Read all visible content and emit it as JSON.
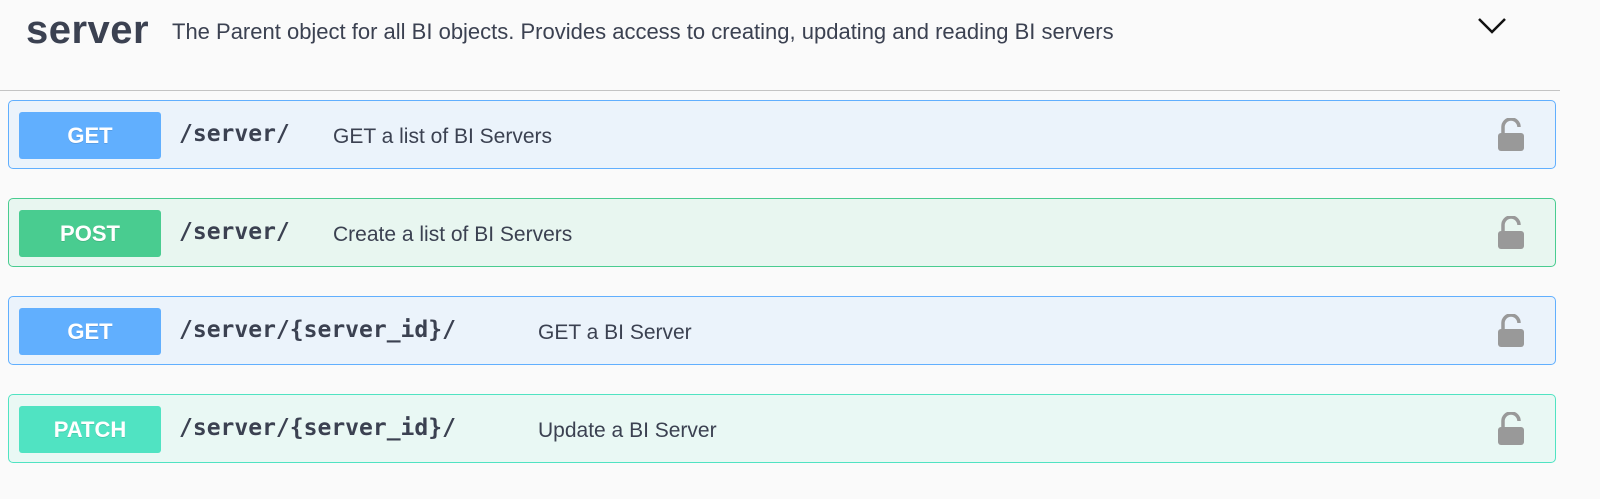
{
  "tag": {
    "name": "server",
    "description": "The Parent object for all BI objects. Provides access to creating, updating and reading BI servers"
  },
  "operations": [
    {
      "method": "GET",
      "path": "/server/",
      "summary": "GET a list of BI Servers"
    },
    {
      "method": "POST",
      "path": "/server/",
      "summary": "Create a list of BI Servers"
    },
    {
      "method": "GET",
      "path": "/server/{server_id}/",
      "summary": "GET a BI Server"
    },
    {
      "method": "PATCH",
      "path": "/server/{server_id}/",
      "summary": "Update a BI Server"
    }
  ],
  "icons": {
    "collapse": "chevron-down-icon",
    "lock": "unlocked-padlock-icon"
  },
  "colors": {
    "get": "#61affe",
    "post": "#49cc90",
    "patch": "#50e3c2",
    "text": "#3b4151",
    "lock": "#999999"
  }
}
